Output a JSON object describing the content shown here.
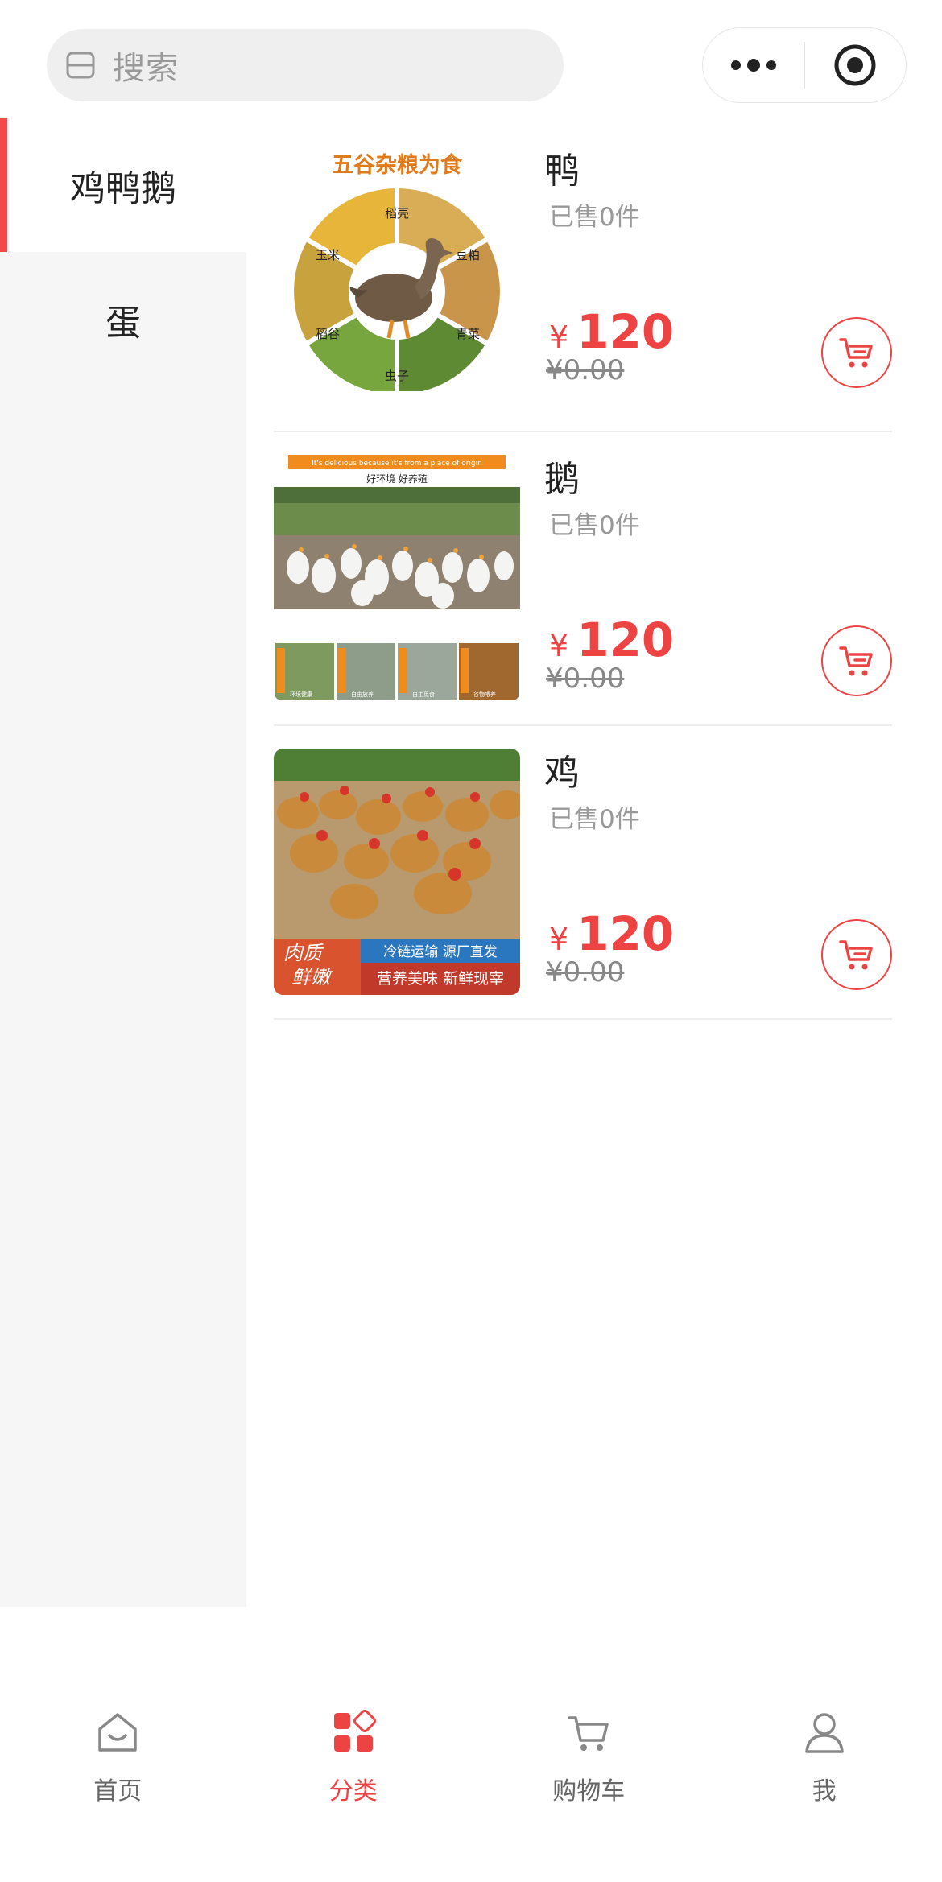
{
  "search": {
    "placeholder": "搜索",
    "icon": "scan-icon"
  },
  "capsule": {
    "more_icon": "more-dots-icon",
    "close_icon": "target-circle-icon"
  },
  "sidebar": {
    "items": [
      {
        "label": "鸡鸭鹅",
        "active": true
      },
      {
        "label": "蛋",
        "active": false
      }
    ]
  },
  "products": [
    {
      "name": "鸭",
      "sold": "已售0件",
      "currency": "¥",
      "price": "120",
      "original_price": "¥0.00",
      "image": {
        "title": "五谷杂粮为食",
        "segments": [
          "稻壳",
          "豆粕",
          "青菜",
          "虫子",
          "稻谷",
          "玉米"
        ]
      }
    },
    {
      "name": "鹅",
      "sold": "已售0件",
      "currency": "¥",
      "price": "120",
      "original_price": "¥0.00",
      "image": {
        "banner_en": "It's delicious because it's from a place of origin",
        "banner_cn": "好环境 好养殖",
        "strip": [
          "环境健康",
          "自由放养",
          "自主觅食",
          "谷物喂养"
        ]
      }
    },
    {
      "name": "鸡",
      "sold": "已售0件",
      "currency": "¥",
      "price": "120",
      "original_price": "¥0.00",
      "image": {
        "badge_line1": "肉质",
        "badge_line2": "鲜嫩",
        "line1": "冷链运输  源厂直发",
        "line2": "营养美味 新鲜现宰"
      }
    }
  ],
  "tabbar": {
    "tabs": [
      {
        "label": "首页",
        "icon": "home-icon",
        "active": false
      },
      {
        "label": "分类",
        "icon": "category-icon",
        "active": true
      },
      {
        "label": "购物车",
        "icon": "cart-icon",
        "active": false
      },
      {
        "label": "我",
        "icon": "user-icon",
        "active": false
      }
    ]
  },
  "colors": {
    "accent": "#ee4343",
    "sidebar_bg": "#f6f6f6",
    "search_bg": "#efefef"
  }
}
